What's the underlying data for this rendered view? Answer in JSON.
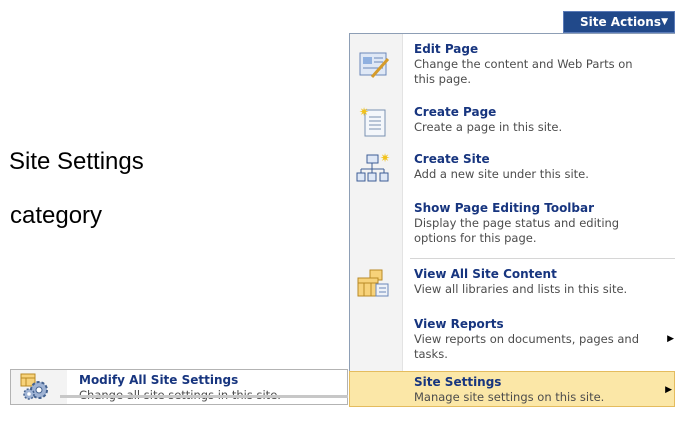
{
  "annotations": {
    "line1": "Site Settings",
    "line2": "category"
  },
  "site_actions": {
    "label": "Site Actions"
  },
  "menu": {
    "items": [
      {
        "title": "Edit Page",
        "desc": "Change the content and Web Parts on this page.",
        "icon": "edit-page-icon"
      },
      {
        "title": "Create Page",
        "desc": "Create a page in this site.",
        "icon": "create-page-icon"
      },
      {
        "title": "Create Site",
        "desc": "Add a new site under this site.",
        "icon": "create-site-icon"
      },
      {
        "title": "Show Page Editing Toolbar",
        "desc": "Display the page status and editing options for this page.",
        "icon": ""
      },
      {
        "title": "View All Site Content",
        "desc": "View all libraries and lists in this site.",
        "icon": "view-all-content-icon"
      },
      {
        "title": "View Reports",
        "desc": "View reports on documents, pages and tasks.",
        "icon": ""
      },
      {
        "title": "Site Settings",
        "desc": "Manage site settings on this site.",
        "icon": ""
      }
    ]
  },
  "submenu": {
    "title": "Modify All Site Settings",
    "desc": "Change all site settings in this site.",
    "icon": "site-settings-gear-icon"
  },
  "colors": {
    "accent": "#21498a",
    "title_text": "#17357f",
    "highlight": "#fbe7a7"
  }
}
